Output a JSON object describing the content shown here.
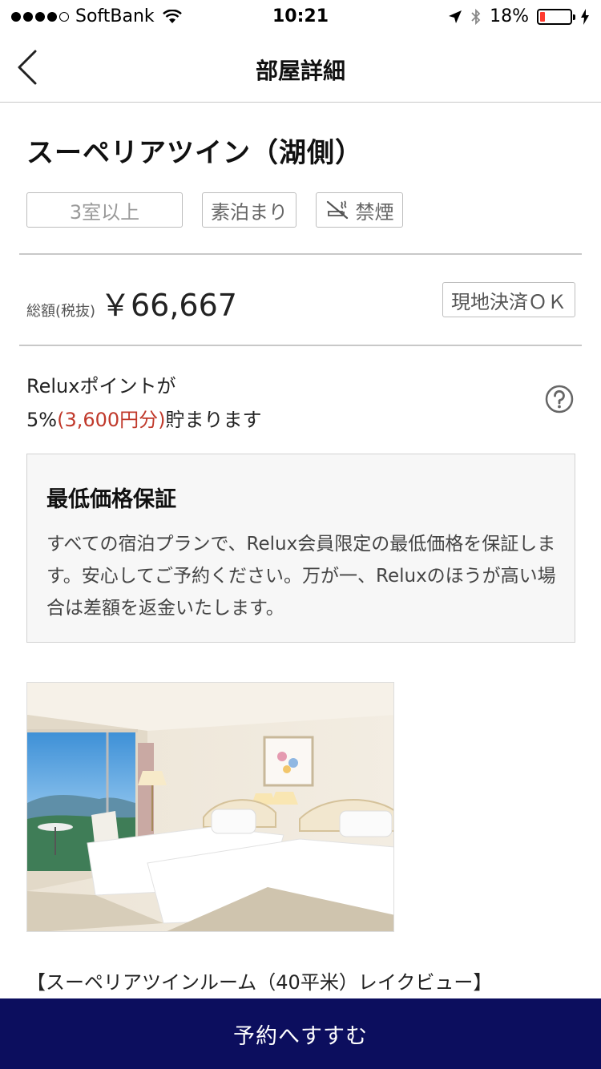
{
  "status_bar": {
    "carrier": "SoftBank",
    "time": "10:21",
    "battery_percent": "18%",
    "battery_level": 0.18,
    "signal_bars": 4
  },
  "nav": {
    "title": "部屋詳細",
    "back_icon": "chevron-left-icon"
  },
  "room": {
    "title": "スーペリアツイン（湖側）",
    "tags": {
      "availability": "3室以上",
      "meal": "素泊まり",
      "smoking": "禁煙"
    }
  },
  "price": {
    "label": "総額(税抜)",
    "value": "￥66,667",
    "payment_badge": "現地決済ＯＫ"
  },
  "points": {
    "line1": "Reluxポイントが",
    "rate": "5%",
    "amount": "(3,600円分)",
    "suffix": "貯まります"
  },
  "guarantee": {
    "title": "最低価格保証",
    "text": "すべての宿泊プランで、Relux会員限定の最低価格を保証します。安心してご予約ください。万が一、Reluxのほうが高い場合は差額を返金いたします。"
  },
  "photo": {
    "caption": "【スーペリアツインルーム（40平米）レイクビュー】"
  },
  "footer": {
    "reserve_label": "予約へすすむ"
  },
  "colors": {
    "accent_red": "#c0392b",
    "reserve_button": "#0c0e5e",
    "battery_low": "#ff3b30"
  }
}
